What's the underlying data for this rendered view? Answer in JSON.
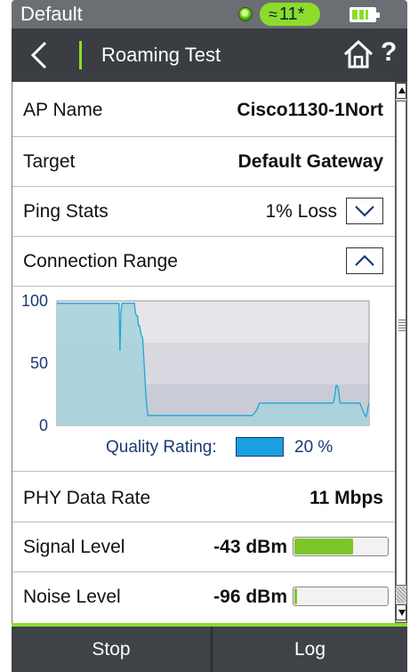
{
  "status_bar": {
    "profile": "Default",
    "wifi_channel": "11*",
    "wifi_glyph": "≈",
    "battery_level": 0.7,
    "icons": [
      "status-led-icon",
      "wifi-icon",
      "battery-icon"
    ]
  },
  "header": {
    "back_glyph": "‹",
    "title": "Roaming Test",
    "help_label": "?",
    "icons": [
      "back-icon",
      "home-icon",
      "help-icon"
    ]
  },
  "rows": {
    "ap_name": {
      "label": "AP Name",
      "value": "Cisco1130-1Nort"
    },
    "target": {
      "label": "Target",
      "value": "Default Gateway"
    },
    "ping_stats": {
      "label": "Ping Stats",
      "value": "1% Loss"
    },
    "connection_range": {
      "label": "Connection Range"
    },
    "phy_rate": {
      "label": "PHY Data Rate",
      "value": "11 Mbps"
    },
    "signal": {
      "label": "Signal Level",
      "value": "-43 dBm",
      "level": 0.63
    },
    "noise": {
      "label": "Noise Level",
      "value": "-96 dBm",
      "level": 0.03
    }
  },
  "chart_data": {
    "type": "area",
    "ylim": [
      0,
      100
    ],
    "y_ticks": [
      "100",
      "50",
      "0"
    ],
    "y_tick_values": [
      100,
      50,
      0
    ],
    "band_colors": [
      "#e6e6ea",
      "#d8d9e0",
      "#c9ccd6"
    ],
    "fill_color": "#a9d3dd",
    "line_color": "#22a3d8",
    "values": [
      98,
      98,
      98,
      98,
      98,
      98,
      98,
      98,
      98,
      98,
      98,
      98,
      98,
      98,
      98,
      98,
      98,
      98,
      98,
      98,
      98,
      98,
      98,
      98,
      98,
      98,
      98,
      98,
      98,
      98,
      98,
      98,
      98,
      98,
      98,
      98,
      98,
      98,
      98,
      98,
      98,
      98,
      98,
      98,
      98,
      98,
      98,
      98,
      98,
      98,
      98,
      98,
      98,
      98,
      98,
      98,
      98,
      98,
      98,
      98,
      98,
      60,
      92,
      98,
      98,
      98,
      98,
      98,
      98,
      98,
      98,
      98,
      98,
      98,
      98,
      98,
      90,
      88,
      88,
      80,
      80,
      75,
      72,
      70,
      55,
      40,
      25,
      15,
      8,
      8,
      8,
      8,
      8,
      8,
      8,
      8,
      8,
      8,
      8,
      8,
      8,
      8,
      8,
      8,
      8,
      8,
      8,
      8,
      8,
      8,
      8,
      8,
      8,
      8,
      8,
      8,
      8,
      8,
      8,
      8,
      8,
      8,
      8,
      8,
      8,
      8,
      8,
      8,
      8,
      8,
      8,
      8,
      8,
      8,
      8,
      8,
      8,
      8,
      8,
      8,
      8,
      8,
      8,
      8,
      8,
      8,
      8,
      8,
      8,
      8,
      8,
      8,
      8,
      8,
      8,
      8,
      8,
      8,
      8,
      8,
      8,
      8,
      8,
      8,
      8,
      8,
      8,
      8,
      8,
      8,
      8,
      8,
      8,
      8,
      8,
      8,
      8,
      8,
      8,
      8,
      8,
      8,
      8,
      8,
      8,
      8,
      8,
      8,
      8,
      8,
      9,
      10,
      11,
      12,
      14,
      16,
      18,
      18,
      18,
      18,
      18,
      18,
      18,
      18,
      18,
      18,
      18,
      18,
      18,
      18,
      18,
      18,
      18,
      18,
      18,
      18,
      18,
      18,
      18,
      18,
      18,
      18,
      18,
      18,
      18,
      18,
      18,
      18,
      18,
      18,
      18,
      18,
      18,
      18,
      18,
      18,
      18,
      18,
      18,
      18,
      18,
      18,
      18,
      18,
      18,
      18,
      18,
      18,
      18,
      18,
      18,
      18,
      18,
      18,
      18,
      18,
      18,
      18,
      18,
      18,
      18,
      18,
      18,
      18,
      18,
      18,
      18,
      18,
      20,
      25,
      32,
      32,
      30,
      25,
      18,
      18,
      18,
      18,
      18,
      18,
      18,
      18,
      18,
      18,
      18,
      18,
      18,
      18,
      18,
      18,
      18,
      18,
      18,
      18,
      16,
      14,
      12,
      10,
      8,
      7,
      10,
      15,
      18
    ]
  },
  "legend": {
    "label": "Quality Rating:",
    "value": "20 %",
    "swatch_color": "#1aa0e0"
  },
  "bottom_bar": {
    "stop_label": "Stop",
    "log_label": "Log"
  }
}
